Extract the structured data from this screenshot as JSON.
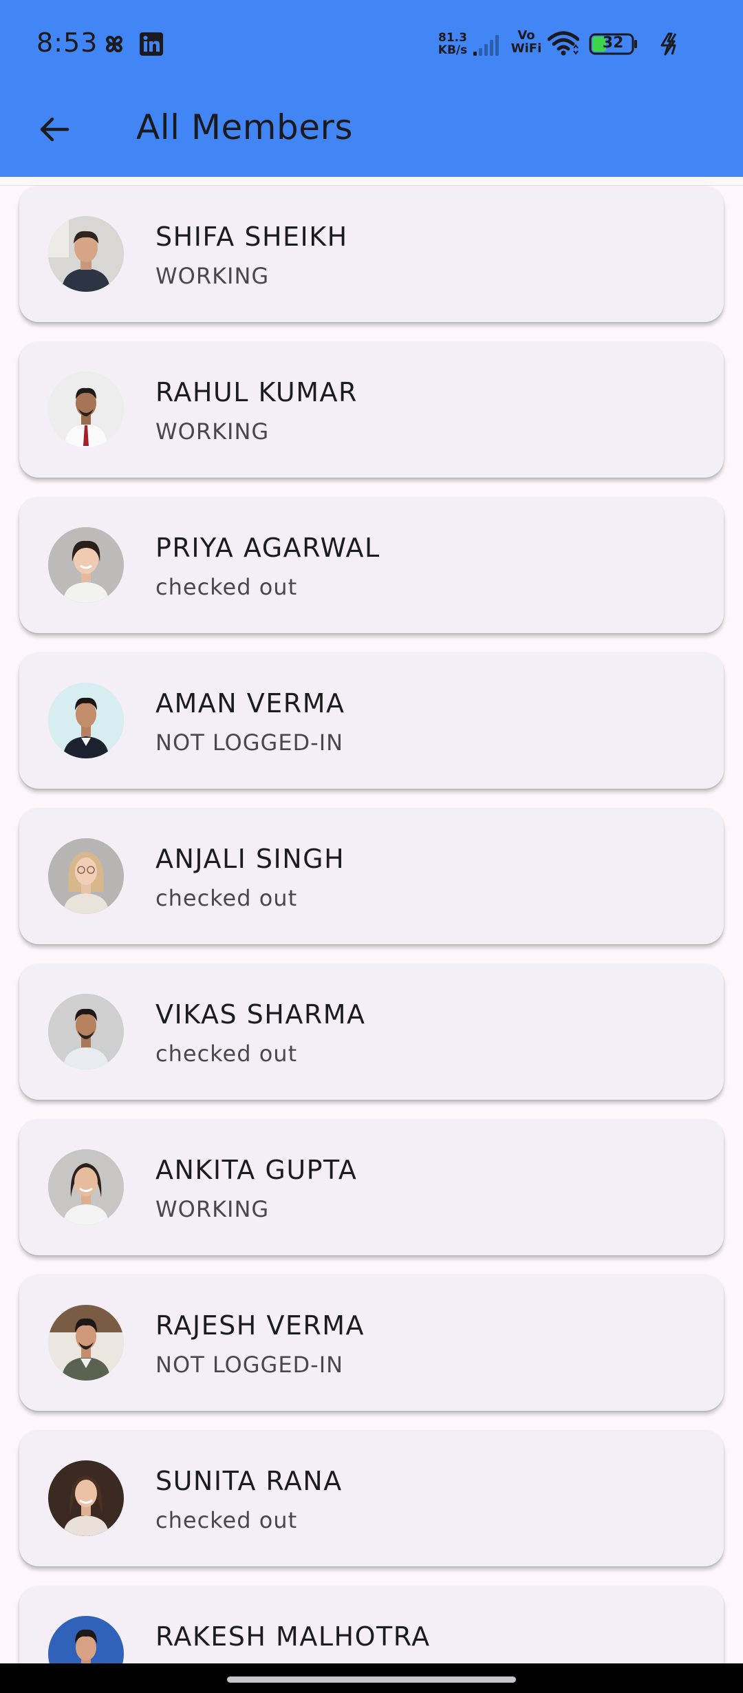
{
  "status_bar": {
    "time": "8:53",
    "net_speed_value": "81.3",
    "net_speed_unit": "KB/s",
    "vo_label": "Vo",
    "wifi_label": "WiFi",
    "battery_level": "32",
    "icons": [
      "pinwheel-icon",
      "linkedin-icon",
      "signal-icon",
      "wifi-icon",
      "battery-icon",
      "charging-icon"
    ]
  },
  "app_bar": {
    "title": "All Members",
    "back_icon": "arrow-left-icon"
  },
  "members": [
    {
      "name": "SHIFA SHEIKH",
      "status": "WORKING"
    },
    {
      "name": "RAHUL KUMAR",
      "status": "WORKING"
    },
    {
      "name": "PRIYA AGARWAL",
      "status": "checked out"
    },
    {
      "name": "AMAN VERMA",
      "status": "NOT LOGGED-IN"
    },
    {
      "name": "ANJALI SINGH",
      "status": "checked out"
    },
    {
      "name": "VIKAS SHARMA",
      "status": "checked out"
    },
    {
      "name": "ANKITA GUPTA",
      "status": "WORKING"
    },
    {
      "name": "RAJESH VERMA",
      "status": "NOT LOGGED-IN"
    },
    {
      "name": "SUNITA RANA",
      "status": "checked out"
    },
    {
      "name": "RAKESH MALHOTRA",
      "status": ""
    }
  ],
  "colors": {
    "header": "#4286f5",
    "card": "#f4eff6",
    "background": "#fdf7fd",
    "battery_fill": "#3fd44a"
  }
}
